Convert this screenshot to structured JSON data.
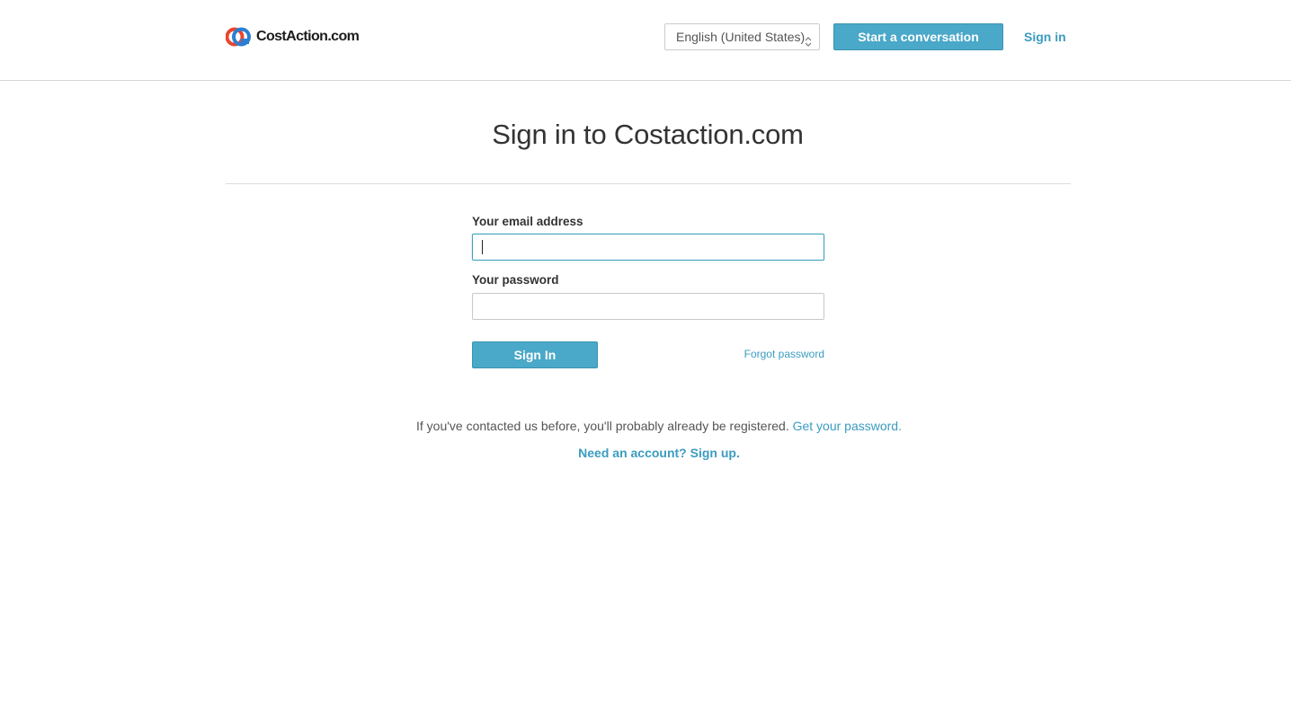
{
  "colors": {
    "accent": "#4aa8c8",
    "link": "#3b9cc0",
    "logo_red": "#e8462f",
    "logo_blue": "#2a7fd4"
  },
  "header": {
    "logo_text": "CostAction.com",
    "language_select": {
      "selected": "English (United States)"
    },
    "start_conversation_label": "Start a conversation",
    "sign_in_label": "Sign in"
  },
  "main": {
    "title": "Sign in to Costaction.com",
    "email": {
      "label": "Your email address",
      "value": "",
      "placeholder": ""
    },
    "password": {
      "label": "Your password",
      "value": "",
      "placeholder": ""
    },
    "sign_in_button_label": "Sign In",
    "forgot_password_label": "Forgot password",
    "registered_note": "If you've contacted us before, you'll probably already be registered.",
    "get_password_link": "Get your password.",
    "signup_link": "Need an account? Sign up."
  }
}
